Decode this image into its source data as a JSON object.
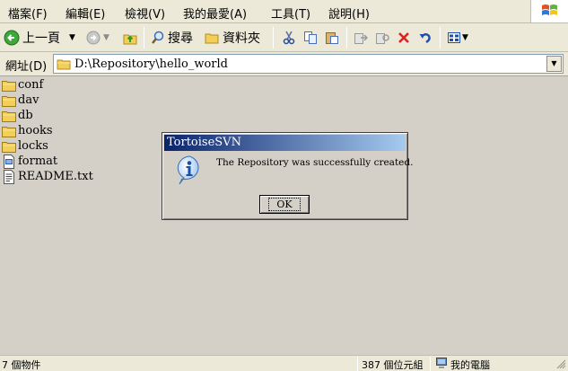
{
  "menu": {
    "items": [
      "檔案(F)",
      "編輯(E)",
      "檢視(V)",
      "我的最愛(A)",
      "工具(T)",
      "說明(H)"
    ]
  },
  "toolbar": {
    "back_label": "上一頁",
    "search_label": "搜尋",
    "folders_label": "資料夾"
  },
  "address": {
    "label": "網址(D)",
    "path": "D:\\Repository\\hello_world"
  },
  "files": [
    {
      "name": "conf",
      "type": "folder"
    },
    {
      "name": "dav",
      "type": "folder"
    },
    {
      "name": "db",
      "type": "folder"
    },
    {
      "name": "hooks",
      "type": "folder"
    },
    {
      "name": "locks",
      "type": "folder"
    },
    {
      "name": "format",
      "type": "file"
    },
    {
      "name": "README.txt",
      "type": "textfile"
    }
  ],
  "dialog": {
    "title": "TortoiseSVN",
    "message": "The Repository was successfully created.",
    "ok_label": "OK",
    "icon": "info-icon"
  },
  "status": {
    "objects": "7 個物件",
    "size": "387 個位元組",
    "location": "我的電腦"
  }
}
